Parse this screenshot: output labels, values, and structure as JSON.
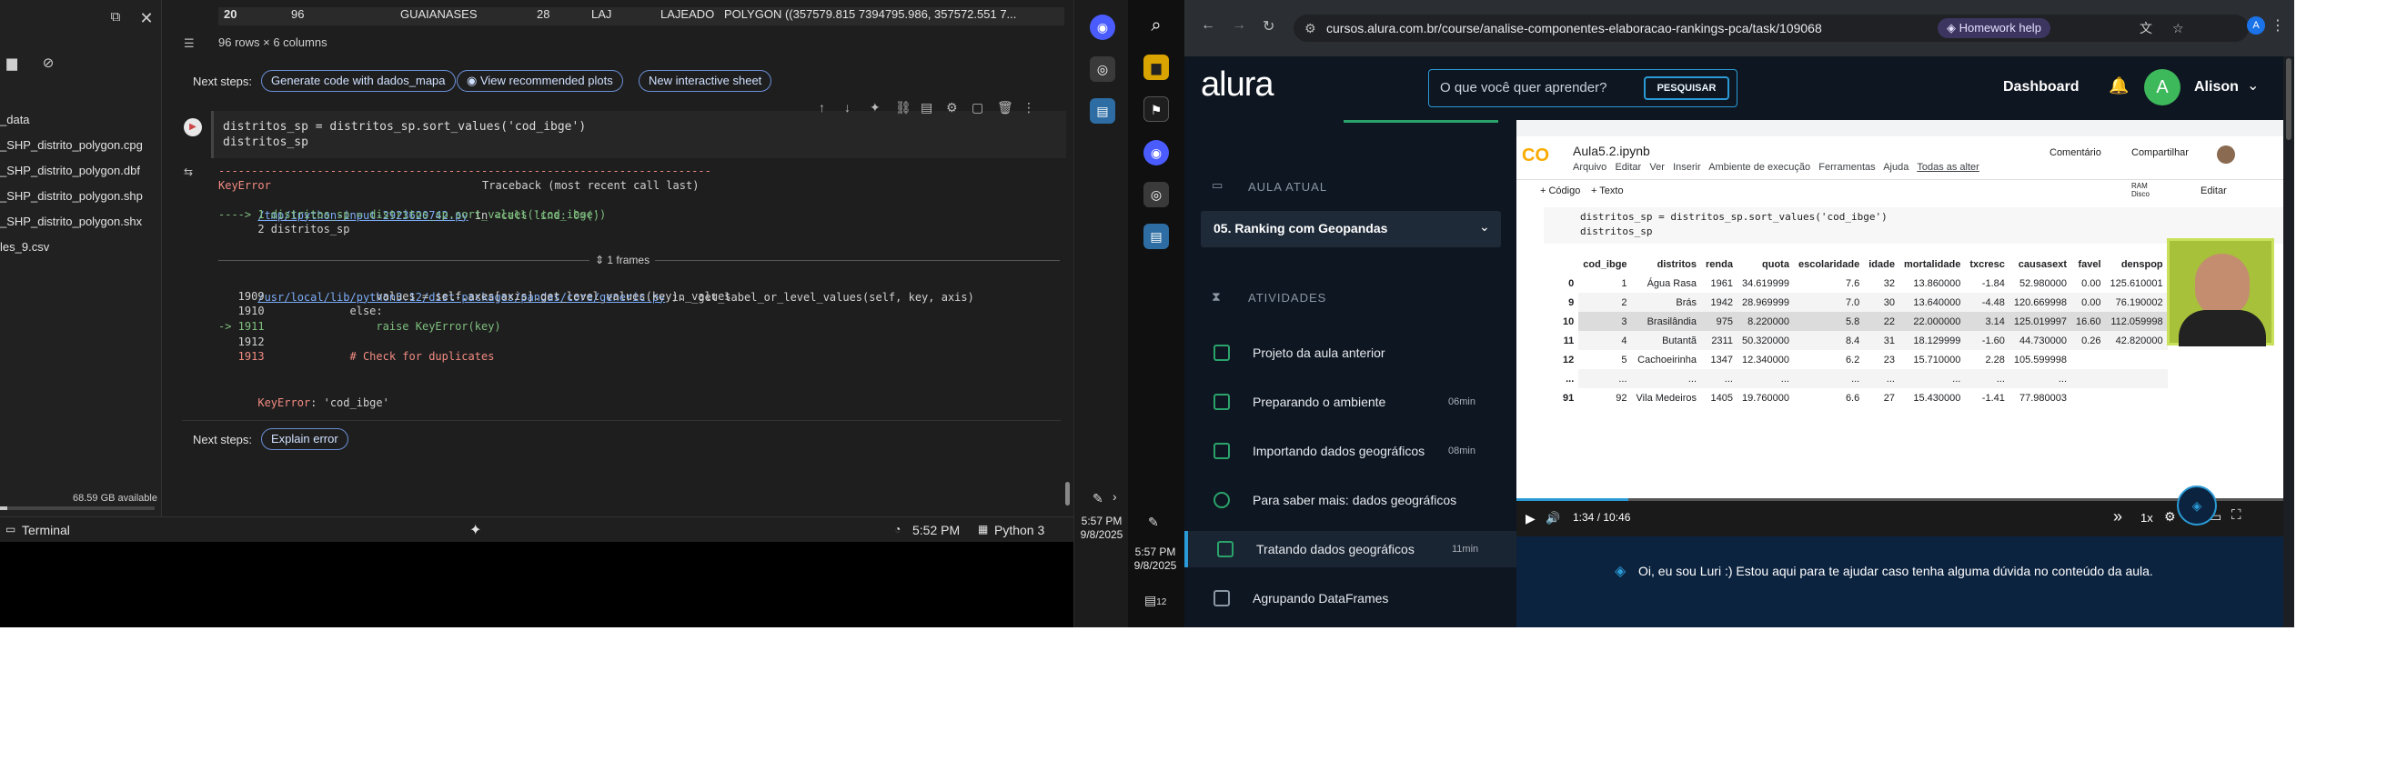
{
  "colab": {
    "header_row": {
      "index": "20",
      "code": "96",
      "district": "GUAIANASES",
      "num": "28",
      "abbr": "LAJ",
      "other": "LAJEADO",
      "geom": "POLYGON ((357579.815 7394795.986, 357572.551 7..."
    },
    "shape_text": "96 rows × 6 columns",
    "next_steps_label": "Next steps:",
    "chips": [
      "Generate code with dados_mapa",
      "View recommended plots",
      "New interactive sheet"
    ],
    "files": [
      "_data",
      "_SHP_distrito_polygon.cpg",
      "_SHP_distrito_polygon.dbf",
      "_SHP_distrito_polygon.shp",
      "_SHP_distrito_polygon.shx",
      "les_9.csv"
    ],
    "disk_label": "68.59 GB available",
    "code_lines": [
      "distritos_sp = distritos_sp.sort_values('cod_ibge')",
      "distritos_sp"
    ],
    "traceback": {
      "rule": "---------------------------------------------------------------------------",
      "error_name": "KeyError",
      "header_right": "Traceback (most recent call last)",
      "tmp_link": "/tmp/ipython-input-2923620742.py",
      "in_text": " in ",
      "cell_line": "<cell line: 0>()",
      "arrow_line": "----> 1 distritos_sp = distritos_sp.sort_values('cod_ibge')",
      "line2": "      2 distritos_sp",
      "frames": "1 frames",
      "lib_link": "/usr/local/lib/python3.12/dist-packages/pandas/core/generic.py",
      "lib_fn": " in _get_label_or_level_values(self, key, axis)",
      "l1909": "   1909                 values = self.axes[axis].get_level_values(key)._values",
      "l1910": "   1910             else:",
      "l1911": "-> 1911                 raise KeyError(key)",
      "l1912": "   1912",
      "l1913": "   1913             # Check for duplicates",
      "final_name": "KeyError",
      "final_msg": ": 'cod_ibge'"
    },
    "explain_chip": "Explain error",
    "status": {
      "terminal": "Terminal",
      "time": "5:52 PM",
      "kernel": "Python 3"
    }
  },
  "taskbar": {
    "time_left": "5:57 PM",
    "date_left": "9/8/2025",
    "time_right": "5:57 PM",
    "date_right": "9/8/2025",
    "notif_count": "12"
  },
  "chrome": {
    "url": "cursos.alura.com.br/course/analise-componentes-elaboracao-rankings-pca/task/109068",
    "homework": "Homework help",
    "profile_letter": "A"
  },
  "alura": {
    "logo": "alura",
    "search_placeholder": "O que você quer aprender?",
    "search_btn": "PESQUISAR",
    "dashboard": "Dashboard",
    "user_letter": "A",
    "user_name": "Alison",
    "aula_atual": "AULA ATUAL",
    "aula_title": "05. Ranking com Geopandas",
    "atividades": "ATIVIDADES",
    "activities": [
      {
        "label": "Projeto da aula anterior",
        "dur": ""
      },
      {
        "label": "Preparando o ambiente",
        "dur": "06min"
      },
      {
        "label": "Importando dados geográficos",
        "dur": "08min"
      },
      {
        "label": "Para saber mais: dados geográficos",
        "dur": ""
      },
      {
        "label": "Tratando dados geográficos",
        "dur": "11min"
      },
      {
        "label": "Agrupando DataFrames",
        "dur": ""
      }
    ],
    "luri": "Oi, eu sou Luri :) Estou aqui para te ajudar caso tenha alguma dúvida no conteúdo da aula."
  },
  "video": {
    "notebook_title": "Aula5.2.ipynb",
    "menu": [
      "Arquivo",
      "Editar",
      "Ver",
      "Inserir",
      "Ambiente de execução",
      "Ferramentas",
      "Ajuda",
      "Todas as alter"
    ],
    "comment": "Comentário",
    "share": "Compartilhar",
    "add_code": "+ Código",
    "add_text": "+ Texto",
    "ram": "RAM",
    "disk": "Disco",
    "edit": "Editar",
    "code": [
      "distritos_sp = distritos_sp.sort_values('cod_ibge')",
      "distritos_sp"
    ],
    "columns": [
      "",
      "cod_ibge",
      "distritos",
      "renda",
      "quota",
      "escolaridade",
      "idade",
      "mortalidade",
      "txcresc",
      "causasext",
      "favel",
      "denspop"
    ],
    "rows": [
      [
        "0",
        "1",
        "Água Rasa",
        "1961",
        "34.619999",
        "7.6",
        "32",
        "13.860000",
        "-1.84",
        "52.980000",
        "0.00",
        "125.610001"
      ],
      [
        "9",
        "2",
        "Brás",
        "1942",
        "28.969999",
        "7.0",
        "30",
        "13.640000",
        "-4.48",
        "120.669998",
        "0.00",
        "76.190002"
      ],
      [
        "10",
        "3",
        "Brasilândia",
        "975",
        "8.220000",
        "5.8",
        "22",
        "22.000000",
        "3.14",
        "125.019997",
        "16.60",
        "112.059998"
      ],
      [
        "11",
        "4",
        "Butantã",
        "2311",
        "50.320000",
        "8.4",
        "31",
        "18.129999",
        "-1.60",
        "44.730000",
        "0.26",
        "42.820000"
      ],
      [
        "12",
        "5",
        "Cachoeirinha",
        "1347",
        "12.340000",
        "6.2",
        "23",
        "15.710000",
        "2.28",
        "105.599998",
        "",
        ""
      ],
      [
        "...",
        "...",
        "...",
        "...",
        "...",
        "...",
        "...",
        "...",
        "...",
        "...",
        "",
        ""
      ],
      [
        "91",
        "92",
        "Vila Medeiros",
        "1405",
        "19.760000",
        "6.6",
        "27",
        "15.430000",
        "-1.41",
        "77.980003",
        "",
        ""
      ]
    ],
    "time": "1:34 / 10:46",
    "speed": "1x",
    "progress": 0.144
  }
}
